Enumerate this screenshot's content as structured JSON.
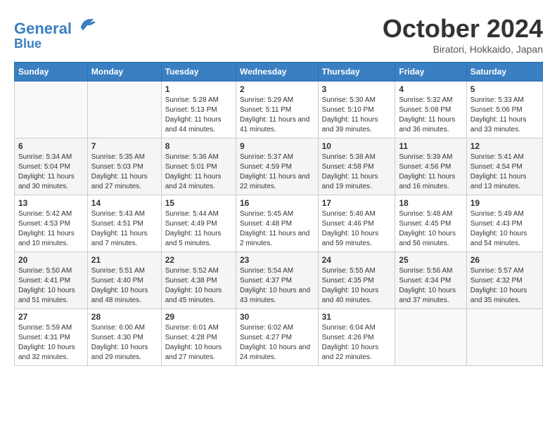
{
  "header": {
    "logo_line1": "General",
    "logo_line2": "Blue",
    "title": "October 2024",
    "subtitle": "Biratori, Hokkaido, Japan"
  },
  "columns": [
    "Sunday",
    "Monday",
    "Tuesday",
    "Wednesday",
    "Thursday",
    "Friday",
    "Saturday"
  ],
  "weeks": [
    [
      {
        "day": "",
        "detail": ""
      },
      {
        "day": "",
        "detail": ""
      },
      {
        "day": "1",
        "detail": "Sunrise: 5:28 AM\nSunset: 5:13 PM\nDaylight: 11 hours and 44 minutes."
      },
      {
        "day": "2",
        "detail": "Sunrise: 5:29 AM\nSunset: 5:11 PM\nDaylight: 11 hours and 41 minutes."
      },
      {
        "day": "3",
        "detail": "Sunrise: 5:30 AM\nSunset: 5:10 PM\nDaylight: 11 hours and 39 minutes."
      },
      {
        "day": "4",
        "detail": "Sunrise: 5:32 AM\nSunset: 5:08 PM\nDaylight: 11 hours and 36 minutes."
      },
      {
        "day": "5",
        "detail": "Sunrise: 5:33 AM\nSunset: 5:06 PM\nDaylight: 11 hours and 33 minutes."
      }
    ],
    [
      {
        "day": "6",
        "detail": "Sunrise: 5:34 AM\nSunset: 5:04 PM\nDaylight: 11 hours and 30 minutes."
      },
      {
        "day": "7",
        "detail": "Sunrise: 5:35 AM\nSunset: 5:03 PM\nDaylight: 11 hours and 27 minutes."
      },
      {
        "day": "8",
        "detail": "Sunrise: 5:36 AM\nSunset: 5:01 PM\nDaylight: 11 hours and 24 minutes."
      },
      {
        "day": "9",
        "detail": "Sunrise: 5:37 AM\nSunset: 4:59 PM\nDaylight: 11 hours and 22 minutes."
      },
      {
        "day": "10",
        "detail": "Sunrise: 5:38 AM\nSunset: 4:58 PM\nDaylight: 11 hours and 19 minutes."
      },
      {
        "day": "11",
        "detail": "Sunrise: 5:39 AM\nSunset: 4:56 PM\nDaylight: 11 hours and 16 minutes."
      },
      {
        "day": "12",
        "detail": "Sunrise: 5:41 AM\nSunset: 4:54 PM\nDaylight: 11 hours and 13 minutes."
      }
    ],
    [
      {
        "day": "13",
        "detail": "Sunrise: 5:42 AM\nSunset: 4:53 PM\nDaylight: 11 hours and 10 minutes."
      },
      {
        "day": "14",
        "detail": "Sunrise: 5:43 AM\nSunset: 4:51 PM\nDaylight: 11 hours and 7 minutes."
      },
      {
        "day": "15",
        "detail": "Sunrise: 5:44 AM\nSunset: 4:49 PM\nDaylight: 11 hours and 5 minutes."
      },
      {
        "day": "16",
        "detail": "Sunrise: 5:45 AM\nSunset: 4:48 PM\nDaylight: 11 hours and 2 minutes."
      },
      {
        "day": "17",
        "detail": "Sunrise: 5:46 AM\nSunset: 4:46 PM\nDaylight: 10 hours and 59 minutes."
      },
      {
        "day": "18",
        "detail": "Sunrise: 5:48 AM\nSunset: 4:45 PM\nDaylight: 10 hours and 56 minutes."
      },
      {
        "day": "19",
        "detail": "Sunrise: 5:49 AM\nSunset: 4:43 PM\nDaylight: 10 hours and 54 minutes."
      }
    ],
    [
      {
        "day": "20",
        "detail": "Sunrise: 5:50 AM\nSunset: 4:41 PM\nDaylight: 10 hours and 51 minutes."
      },
      {
        "day": "21",
        "detail": "Sunrise: 5:51 AM\nSunset: 4:40 PM\nDaylight: 10 hours and 48 minutes."
      },
      {
        "day": "22",
        "detail": "Sunrise: 5:52 AM\nSunset: 4:38 PM\nDaylight: 10 hours and 45 minutes."
      },
      {
        "day": "23",
        "detail": "Sunrise: 5:54 AM\nSunset: 4:37 PM\nDaylight: 10 hours and 43 minutes."
      },
      {
        "day": "24",
        "detail": "Sunrise: 5:55 AM\nSunset: 4:35 PM\nDaylight: 10 hours and 40 minutes."
      },
      {
        "day": "25",
        "detail": "Sunrise: 5:56 AM\nSunset: 4:34 PM\nDaylight: 10 hours and 37 minutes."
      },
      {
        "day": "26",
        "detail": "Sunrise: 5:57 AM\nSunset: 4:32 PM\nDaylight: 10 hours and 35 minutes."
      }
    ],
    [
      {
        "day": "27",
        "detail": "Sunrise: 5:59 AM\nSunset: 4:31 PM\nDaylight: 10 hours and 32 minutes."
      },
      {
        "day": "28",
        "detail": "Sunrise: 6:00 AM\nSunset: 4:30 PM\nDaylight: 10 hours and 29 minutes."
      },
      {
        "day": "29",
        "detail": "Sunrise: 6:01 AM\nSunset: 4:28 PM\nDaylight: 10 hours and 27 minutes."
      },
      {
        "day": "30",
        "detail": "Sunrise: 6:02 AM\nSunset: 4:27 PM\nDaylight: 10 hours and 24 minutes."
      },
      {
        "day": "31",
        "detail": "Sunrise: 6:04 AM\nSunset: 4:26 PM\nDaylight: 10 hours and 22 minutes."
      },
      {
        "day": "",
        "detail": ""
      },
      {
        "day": "",
        "detail": ""
      }
    ]
  ]
}
